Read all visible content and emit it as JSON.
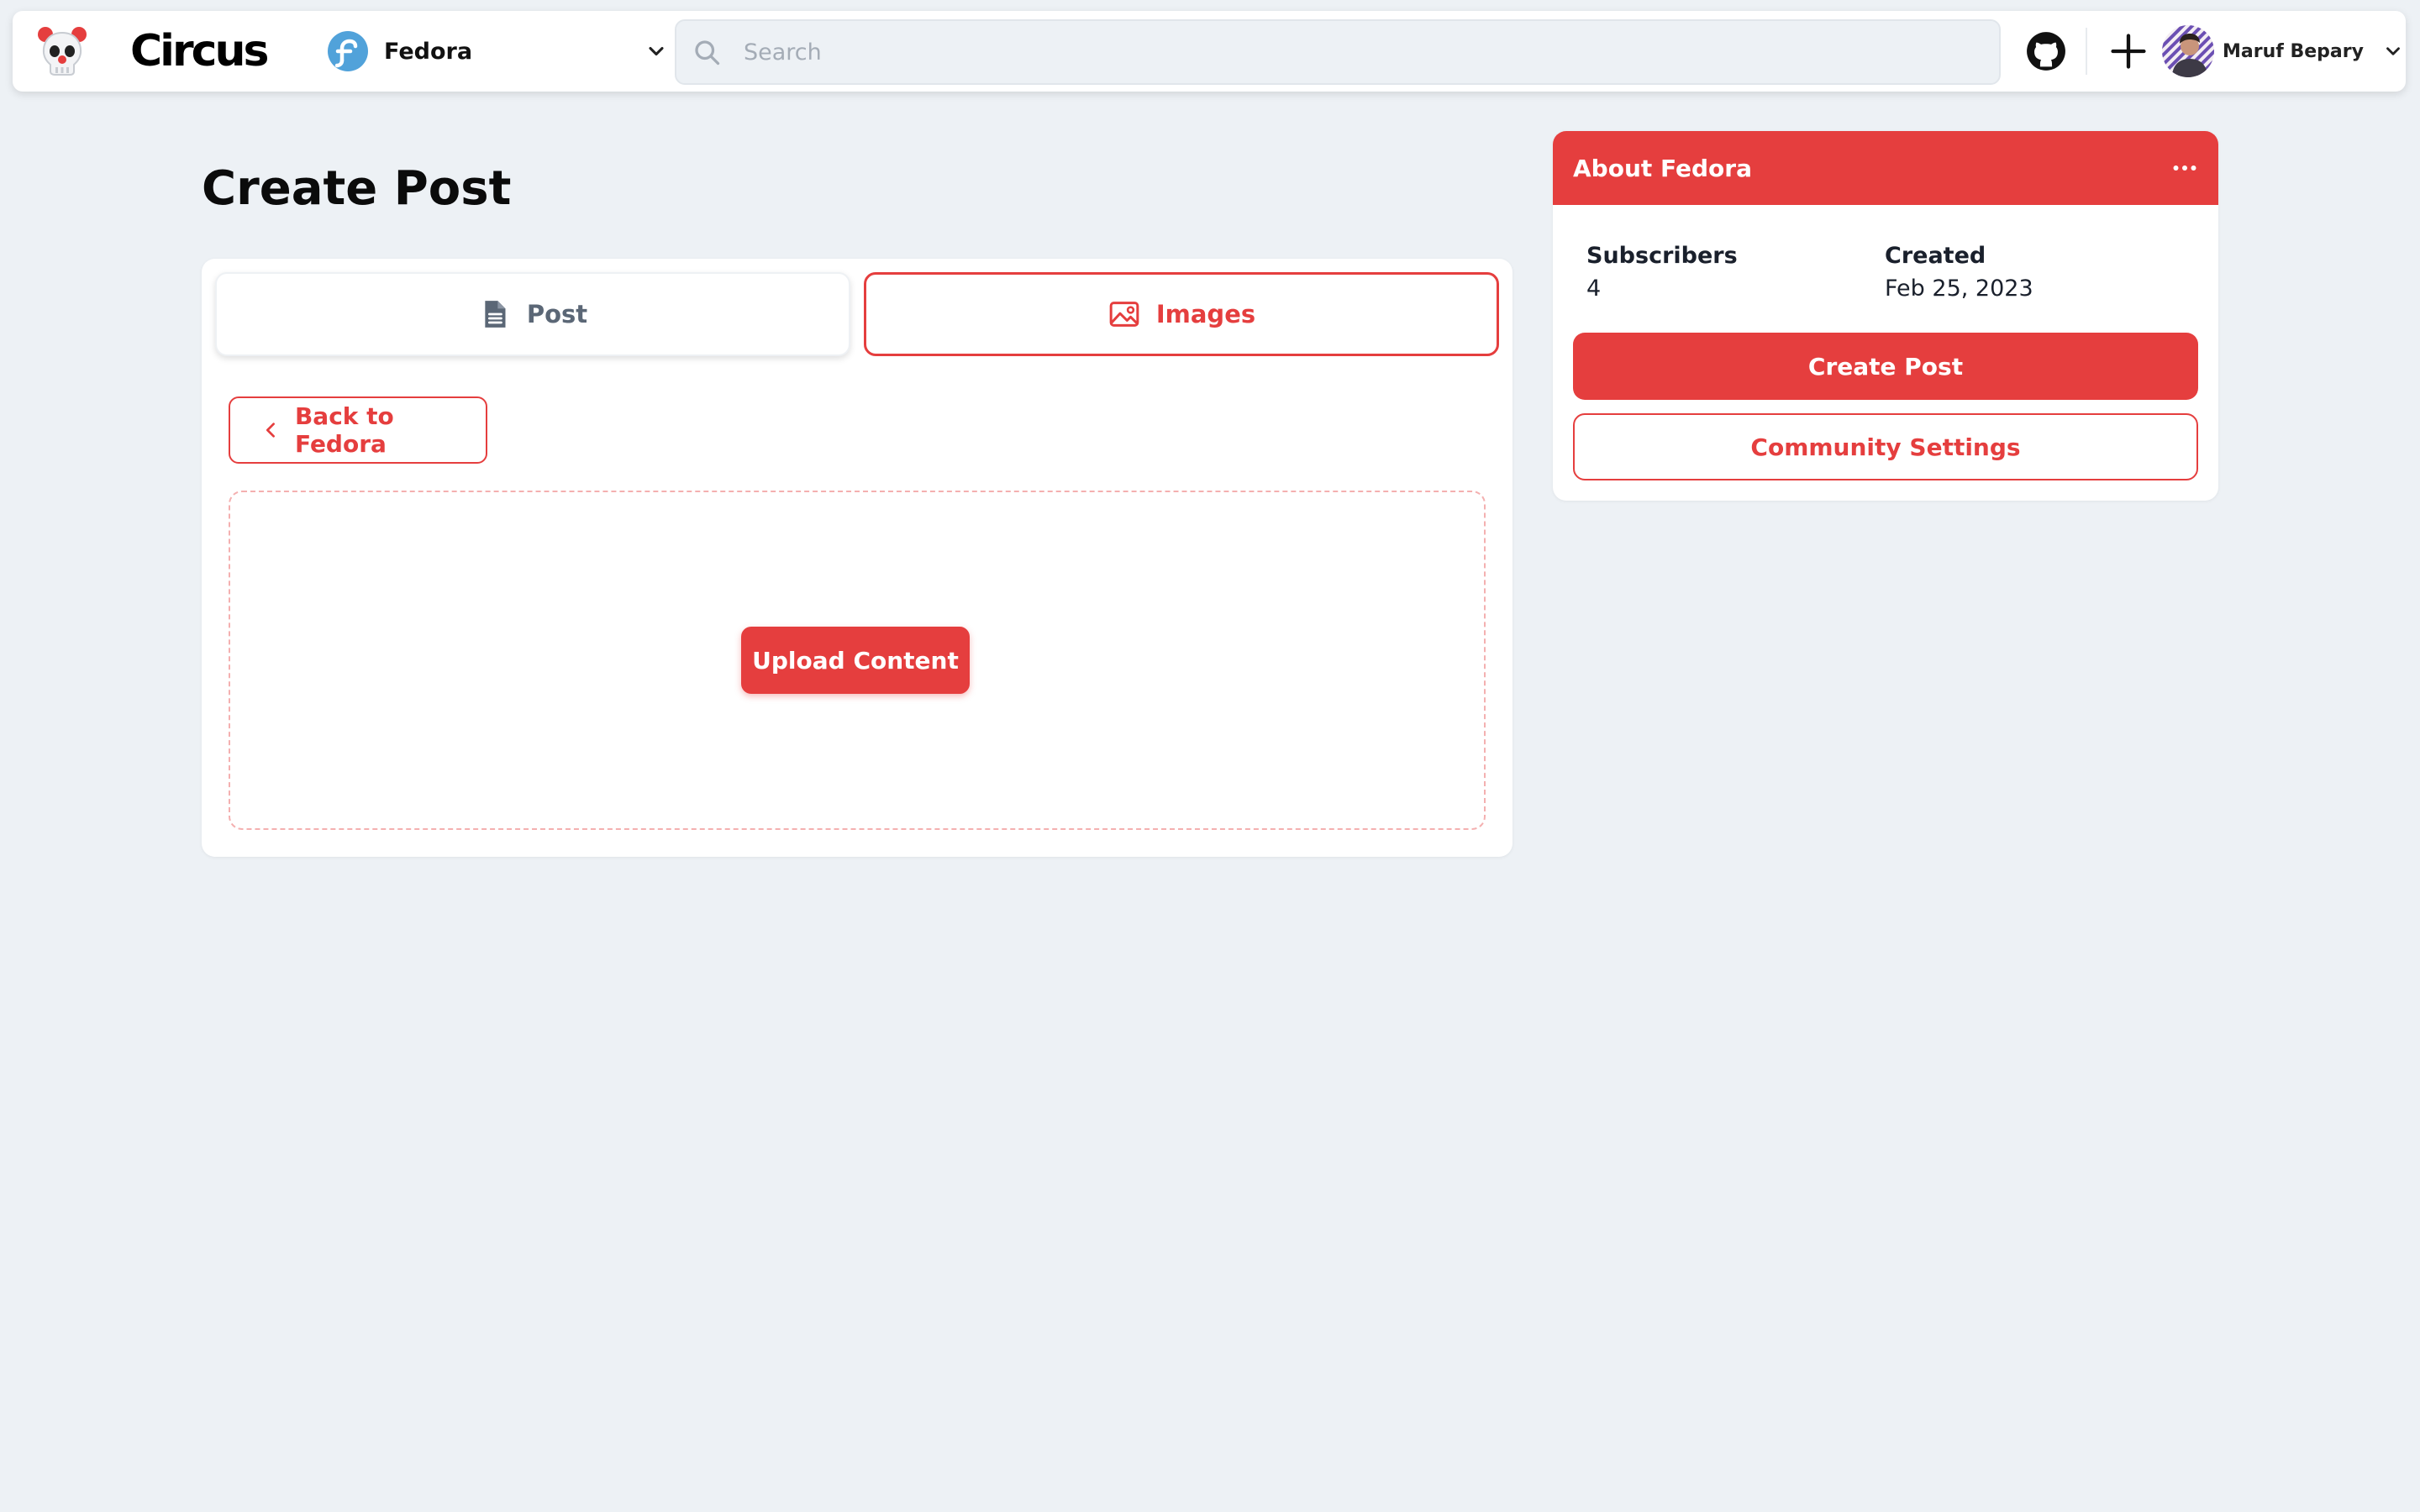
{
  "app": {
    "brand": "Circus"
  },
  "nav": {
    "community": "Fedora",
    "search_placeholder": "Search",
    "user_name": "Maruf Bepary"
  },
  "icons": {
    "logo": "clown-skull-icon",
    "community": "fedora-icon",
    "search": "search-icon",
    "github": "github-icon",
    "create": "plus-icon",
    "avatar": "user-avatar",
    "chevron": "chevron-down-icon",
    "post_tab": "document-icon",
    "images_tab": "image-icon",
    "back": "chevron-left-icon",
    "more": "more-horizontal-icon"
  },
  "colors": {
    "accent": "#e53e3e",
    "background": "#edf1f5",
    "fedora_blue": "#51a2da"
  },
  "main": {
    "title": "Create Post",
    "tabs": [
      {
        "label": "Post",
        "active": false
      },
      {
        "label": "Images",
        "active": true
      }
    ],
    "back_label": "Back to Fedora",
    "upload_label": "Upload Content"
  },
  "sidebar": {
    "title": "About Fedora",
    "subscribers_label": "Subscribers",
    "subscribers_value": "4",
    "created_label": "Created",
    "created_value": "Feb 25, 2023",
    "create_post_label": "Create Post",
    "community_settings_label": "Community Settings"
  }
}
